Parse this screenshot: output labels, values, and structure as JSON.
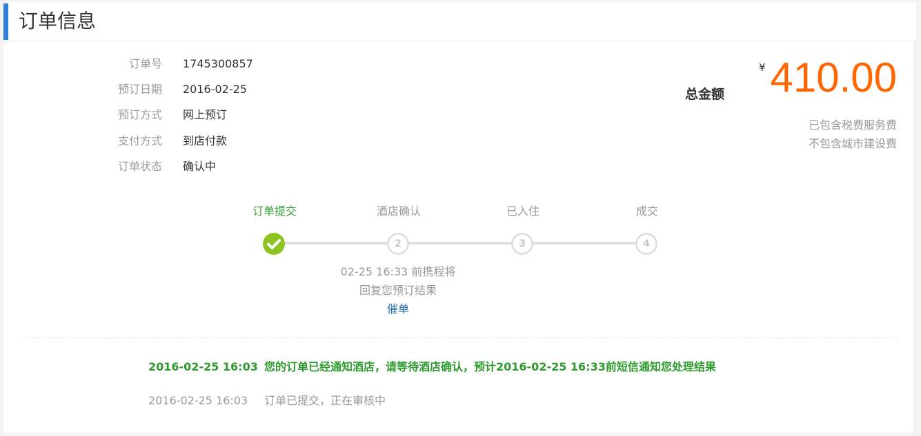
{
  "header": {
    "title": "订单信息"
  },
  "order_info": [
    {
      "label": "订单号",
      "value": "1745300857"
    },
    {
      "label": "预订日期",
      "value": "2016-02-25"
    },
    {
      "label": "预订方式",
      "value": "网上预订"
    },
    {
      "label": "支付方式",
      "value": "到店付款"
    },
    {
      "label": "订单状态",
      "value": "确认中"
    }
  ],
  "total": {
    "label": "总金额",
    "currency": "¥",
    "amount": "410.00",
    "note1": "已包含税费服务费",
    "note2": "不包含城市建设费"
  },
  "progress": {
    "steps": [
      {
        "label": "订单提交",
        "status": "done",
        "marker": "check-icon"
      },
      {
        "label": "酒店确认",
        "status": "pending",
        "marker": "2"
      },
      {
        "label": "已入住",
        "status": "pending",
        "marker": "3"
      },
      {
        "label": "成交",
        "status": "pending",
        "marker": "4"
      }
    ],
    "note_line1": "02-25 16:33 前携程将",
    "note_line2": "回复您预订结果",
    "urge_label": "催单"
  },
  "log": [
    {
      "time": "2016-02-25 16:03",
      "text": "您的订单已经通知酒店，请等待酒店确认，预计2016-02-25 16:33前短信通知您处理结果",
      "style": "green"
    },
    {
      "time": "2016-02-25 16:03",
      "text": "订单已提交，正在审核中",
      "style": "gray"
    }
  ],
  "colors": {
    "accent": "#2f7fd9",
    "amount": "#ff6600",
    "success": "#8fc31f",
    "success_text": "#3aa236",
    "link": "#2a6fb5"
  }
}
